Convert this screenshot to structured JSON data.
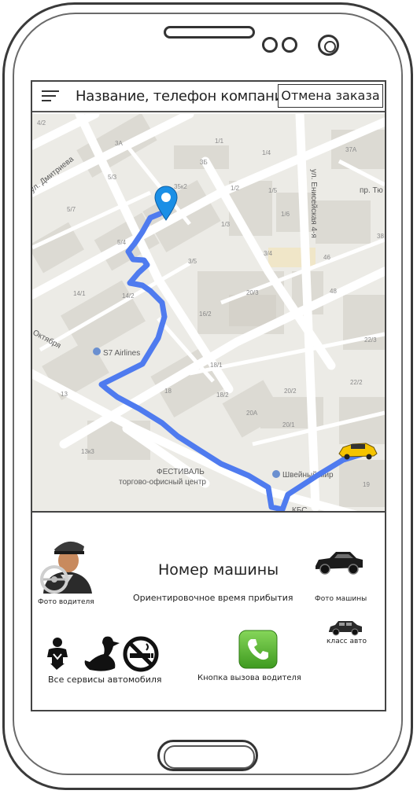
{
  "header": {
    "menu_icon": "hamburger-menu-icon",
    "title": "Название, телефон компании",
    "cancel_label": "Отмена заказа"
  },
  "map": {
    "streets": [
      "ул. Дмитриева",
      "Октября",
      "ул. Енисейская 4-я",
      "пр. Тю"
    ],
    "poi": [
      "S7 Airlines",
      "ФЕСТИВАЛЬ",
      "торгово-офисный центр",
      "Швейный мир",
      "КБС"
    ],
    "house_numbers": [
      "4/2",
      "3А",
      "1/1",
      "1/4",
      "37А",
      "5/3",
      "35к2",
      "1/2",
      "1/5",
      "3Б",
      "5/7",
      "5/4",
      "1/3",
      "1/6",
      "3/4",
      "3/5",
      "14/1",
      "14/2",
      "20/3",
      "16/2",
      "46",
      "48",
      "22/3",
      "18/1",
      "22/2",
      "18",
      "18/2",
      "20/2",
      "20А",
      "20/1",
      "13",
      "13к3",
      "19",
      "38"
    ],
    "destination_pin_icon": "location-pin-icon",
    "car_icon": "taxi-car-icon",
    "route_color": "#4f7bef",
    "map_bg_color": "#ecebe6"
  },
  "panel": {
    "driver_photo_label": "Фото водителя",
    "driver_photo_icon": "driver-avatar-icon",
    "car_number": "Номер машины",
    "eta_label": "Ориентировочное время прибытия",
    "car_photo_label": "Фото машины",
    "car_photo_icon": "car-photo-icon",
    "car_class_label": "класс авто",
    "car_class_icon": "car-class-icon",
    "services_label": "Все сервисы автомобиля",
    "service_icons": [
      "child-seat-icon",
      "pet-icon",
      "no-smoking-icon"
    ],
    "call_label": "Кнопка вызова водителя",
    "call_icon": "phone-call-icon",
    "call_color": "#5cb533"
  }
}
